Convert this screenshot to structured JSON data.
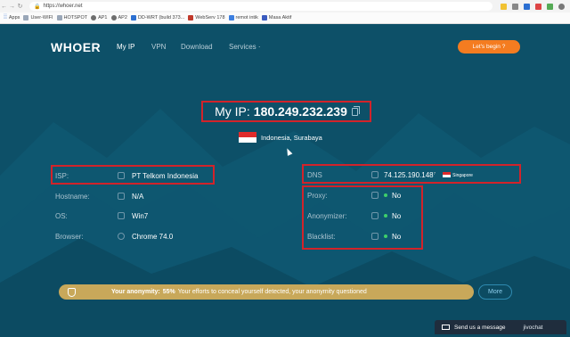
{
  "browser": {
    "url": "https://whoer.net",
    "bookmarks": [
      {
        "label": "Apps",
        "icon": "apps-grid-icon"
      },
      {
        "label": "User-WIFI",
        "icon": "bookmark-icon"
      },
      {
        "label": "HOTSPOT",
        "icon": "bookmark-icon"
      },
      {
        "label": "AP1",
        "icon": "network-icon"
      },
      {
        "label": "AP2",
        "icon": "network-icon"
      },
      {
        "label": "DD-WRT (build 373...",
        "icon": "dd-wrt-icon"
      },
      {
        "label": "WebServ 178",
        "icon": "webserv-icon"
      },
      {
        "label": "remot intik",
        "icon": "remote-icon"
      },
      {
        "label": "Masa Aktif",
        "icon": "ms-icon"
      }
    ]
  },
  "nav": {
    "logo": "WHOER",
    "links": [
      "My IP",
      "VPN",
      "Download",
      "Services ·"
    ],
    "begin_label": "Let's begin ?"
  },
  "myip": {
    "label": "My IP:",
    "ip": "180.249.232.239"
  },
  "location": {
    "text": "Indonesia, Surabaya"
  },
  "left_rows": [
    {
      "label": "ISP:",
      "value": "PT Telkom Indonesia"
    },
    {
      "label": "Hostname:",
      "value": "N/A"
    },
    {
      "label": "OS:",
      "value": "Win7"
    },
    {
      "label": "Browser:",
      "value": "Chrome 74.0"
    }
  ],
  "dns": {
    "label": "DNS",
    "value": "74.125.190.148",
    "superscript": "7",
    "country": "Singapore"
  },
  "right_rows": [
    {
      "label": "Proxy:",
      "value": "No"
    },
    {
      "label": "Anonymizer:",
      "value": "No"
    },
    {
      "label": "Blacklist:",
      "value": "No"
    }
  ],
  "anonymity": {
    "prefix": "Your anonymity:",
    "percent": "55%",
    "message": "Your efforts to conceal yourself detected, your anonymity questioned",
    "more_label": "More"
  },
  "chat": {
    "label": "Send us a message",
    "brand": "jivochat"
  },
  "colors": {
    "page_bg": "#0d5068",
    "accent_orange": "#f47c20",
    "highlight_red": "#d2232a",
    "anonymity_bar": "#c8a85a",
    "status_green": "#3ecf6a"
  }
}
